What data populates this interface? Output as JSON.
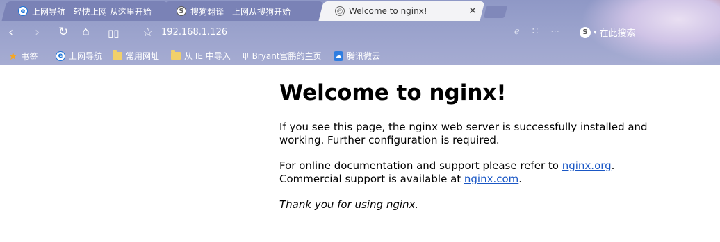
{
  "tabs": [
    {
      "label": "上网导航 - 轻快上网 从这里开始",
      "icon": "ie-e-icon"
    },
    {
      "label": "搜狗翻译 - 上网从搜狗开始",
      "icon": "sogou-icon"
    },
    {
      "label": "Welcome to nginx!",
      "icon": "globe-icon",
      "close": "✕"
    }
  ],
  "address": {
    "url": "192.168.1.126"
  },
  "toolbar": {
    "search_label": "在此搜索"
  },
  "bookmarks": [
    {
      "label": "书签",
      "icon": "star-icon"
    },
    {
      "label": "上网导航",
      "icon": "ie-e-icon"
    },
    {
      "label": "常用网址",
      "icon": "folder-icon"
    },
    {
      "label": "从 IE 中导入",
      "icon": "folder-icon"
    },
    {
      "label": "Bryant宫鹏的主页",
      "icon": "bryant-icon"
    },
    {
      "label": "腾讯微云",
      "icon": "cloud-icon"
    }
  ],
  "page": {
    "title": "Welcome to nginx!",
    "p1": "If you see this page, the nginx web server is successfully installed and working. Further configuration is required.",
    "p2_prefix": "For online documentation and support please refer to ",
    "link1": "nginx.org",
    "p2_mid": ".",
    "p2_line2_prefix": "Commercial support is available at ",
    "link2": "nginx.com",
    "p2_end": ".",
    "p3": "Thank you for using nginx."
  }
}
